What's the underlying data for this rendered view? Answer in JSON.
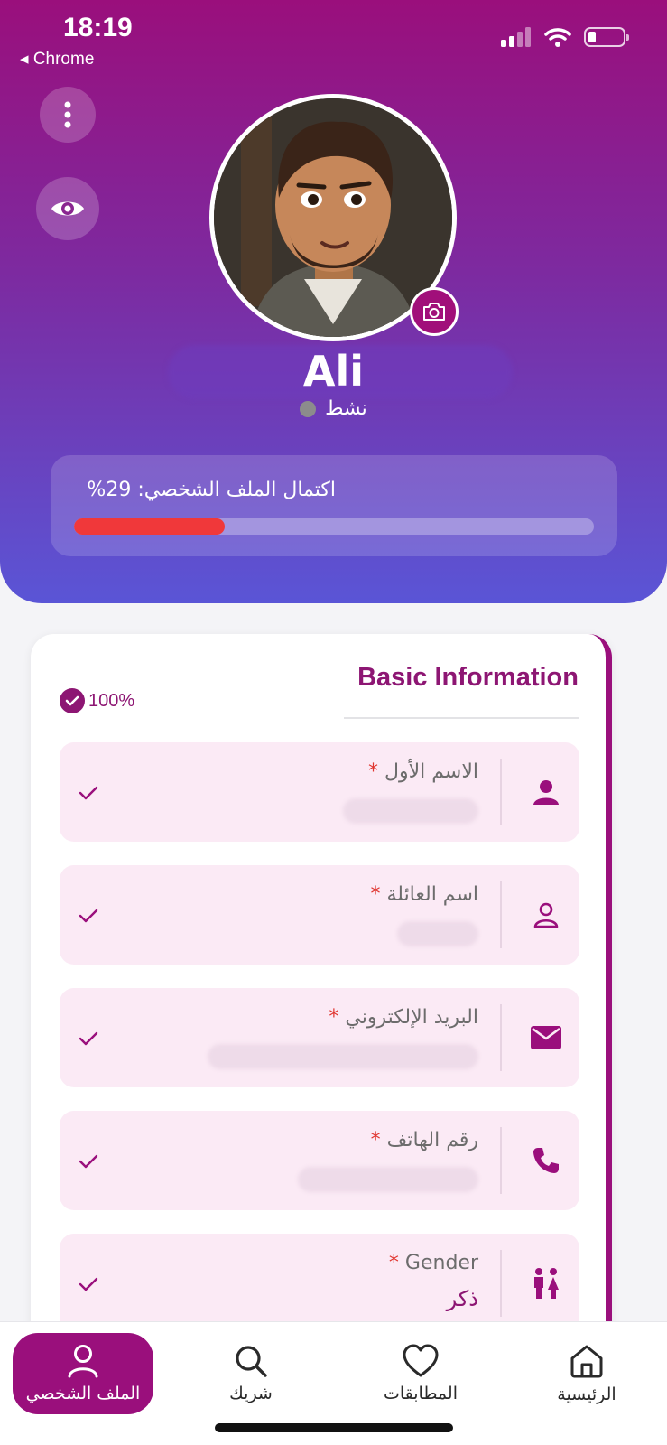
{
  "status_bar": {
    "time": "18:19",
    "back_app": "◂ Chrome"
  },
  "header": {
    "menu_icon": "more-vertical-icon",
    "preview_icon": "eye-icon",
    "camera_icon": "camera-icon",
    "user_name": "Ali",
    "status_text": "نشط",
    "completion_label": "اكتمال الملف الشخصي: 29%",
    "completion_fraction": 0.29,
    "colors": {
      "gradient_top": "#9a0f7c",
      "gradient_bottom": "#5a55d6",
      "progress_fill": "#f0383a"
    }
  },
  "basic_info": {
    "title": "Basic Information",
    "completion": "100%",
    "accent": "#8d1673",
    "fields": [
      {
        "label": "الاسم الأول",
        "required_mark": "*",
        "value": "",
        "icon": "user-filled-icon"
      },
      {
        "label": "اسم العائلة",
        "required_mark": "*",
        "value": "",
        "icon": "user-outline-icon"
      },
      {
        "label": "البريد الإلكتروني",
        "required_mark": "*",
        "value": "",
        "icon": "mail-icon"
      },
      {
        "label": "رقم الهاتف",
        "required_mark": "*",
        "value": "",
        "icon": "phone-icon"
      },
      {
        "label": "Gender",
        "required_mark": "*",
        "value": "ذكر",
        "icon": "gender-icon"
      }
    ]
  },
  "bottom_nav": {
    "items": [
      {
        "label": "الملف الشخصي",
        "icon": "profile-icon",
        "active": true
      },
      {
        "label": "شريك",
        "icon": "search-icon",
        "active": false
      },
      {
        "label": "المطابقات",
        "icon": "heart-icon",
        "active": false
      },
      {
        "label": "الرئيسية",
        "icon": "home-icon",
        "active": false
      }
    ]
  }
}
